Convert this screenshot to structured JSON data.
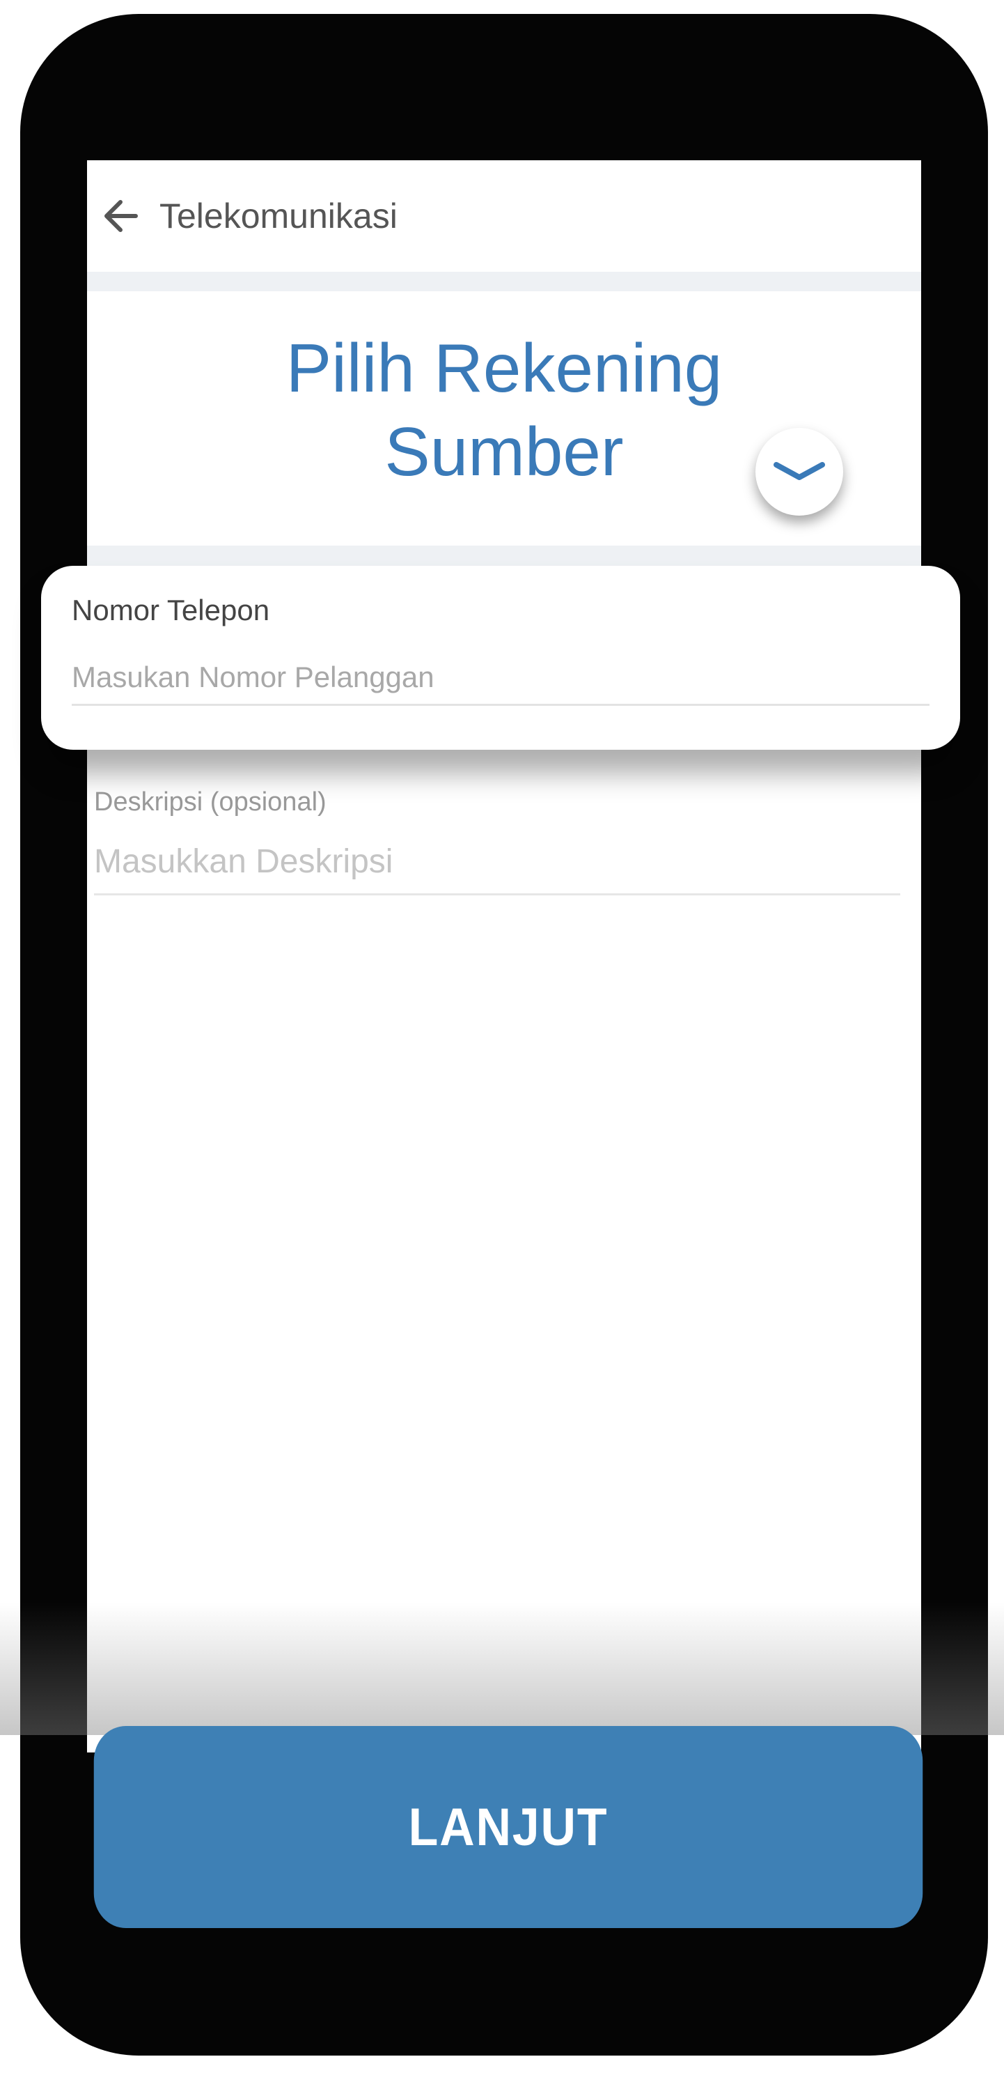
{
  "header": {
    "title": "Telekomunikasi",
    "back_icon": "arrow-left-icon"
  },
  "source_account": {
    "title_line1": "Pilih Rekening",
    "title_line2": "Sumber",
    "expand_icon": "chevron-down-icon"
  },
  "phone_field": {
    "label": "Nomor Telepon",
    "value": "",
    "placeholder": "Masukan Nomor Pelanggan"
  },
  "description_field": {
    "label": "Deskripsi (opsional)",
    "value": "",
    "placeholder": "Masukkan Deskripsi"
  },
  "actions": {
    "next_label": "LANJUT"
  },
  "colors": {
    "accent": "#3a7ab8",
    "button": "#3e80b5",
    "frame": "#050505"
  }
}
